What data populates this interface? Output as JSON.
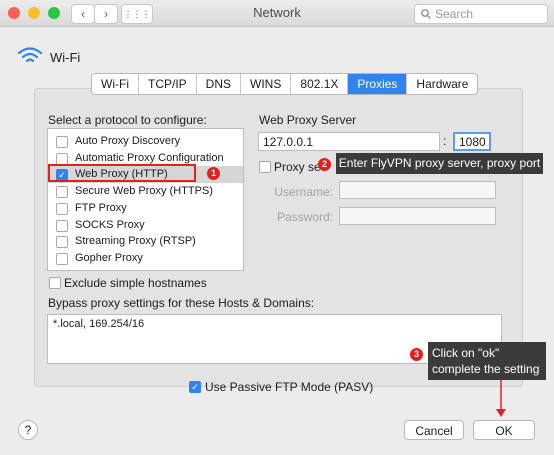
{
  "window": {
    "title": "Network",
    "search_placeholder": "Search",
    "nav_back": "‹",
    "nav_forward": "›",
    "grid_icon": "⋮⋮⋮"
  },
  "header": {
    "label": "Wi-Fi"
  },
  "tabs": [
    {
      "label": "Wi-Fi",
      "active": false
    },
    {
      "label": "TCP/IP",
      "active": false
    },
    {
      "label": "DNS",
      "active": false
    },
    {
      "label": "WINS",
      "active": false
    },
    {
      "label": "802.1X",
      "active": false
    },
    {
      "label": "Proxies",
      "active": true
    },
    {
      "label": "Hardware",
      "active": false
    }
  ],
  "protocols": {
    "heading": "Select a protocol to configure:",
    "items": [
      {
        "label": "Auto Proxy Discovery",
        "checked": false
      },
      {
        "label": "Automatic Proxy Configuration",
        "checked": false
      },
      {
        "label": "Web Proxy (HTTP)",
        "checked": true
      },
      {
        "label": "Secure Web Proxy (HTTPS)",
        "checked": false
      },
      {
        "label": "FTP Proxy",
        "checked": false
      },
      {
        "label": "SOCKS Proxy",
        "checked": false
      },
      {
        "label": "Streaming Proxy (RTSP)",
        "checked": false
      },
      {
        "label": "Gopher Proxy",
        "checked": false
      }
    ]
  },
  "server": {
    "heading": "Web Proxy Server",
    "host": "127.0.0.1",
    "colon": ":",
    "port": "1080",
    "password_checkbox_label": "Proxy se",
    "username_label": "Username:",
    "password_label": "Password:"
  },
  "exclude_simple_label": "Exclude simple hostnames",
  "bypass": {
    "heading": "Bypass proxy settings for these Hosts & Domains:",
    "value": "*.local, 169.254/16"
  },
  "passive_ftp_label": "Use Passive FTP Mode (PASV)",
  "buttons": {
    "help": "?",
    "cancel": "Cancel",
    "ok": "OK"
  },
  "annotations": [
    {
      "number": "1"
    },
    {
      "number": "2",
      "text": "Enter FlyVPN proxy server, proxy port"
    },
    {
      "number": "3",
      "line1": "Click on \"ok\"",
      "line2": "complete the setting"
    }
  ],
  "colors": {
    "accent": "#2f84f0",
    "annotation_red": "#e32020",
    "tooltip_bg": "#3b3b3b"
  }
}
